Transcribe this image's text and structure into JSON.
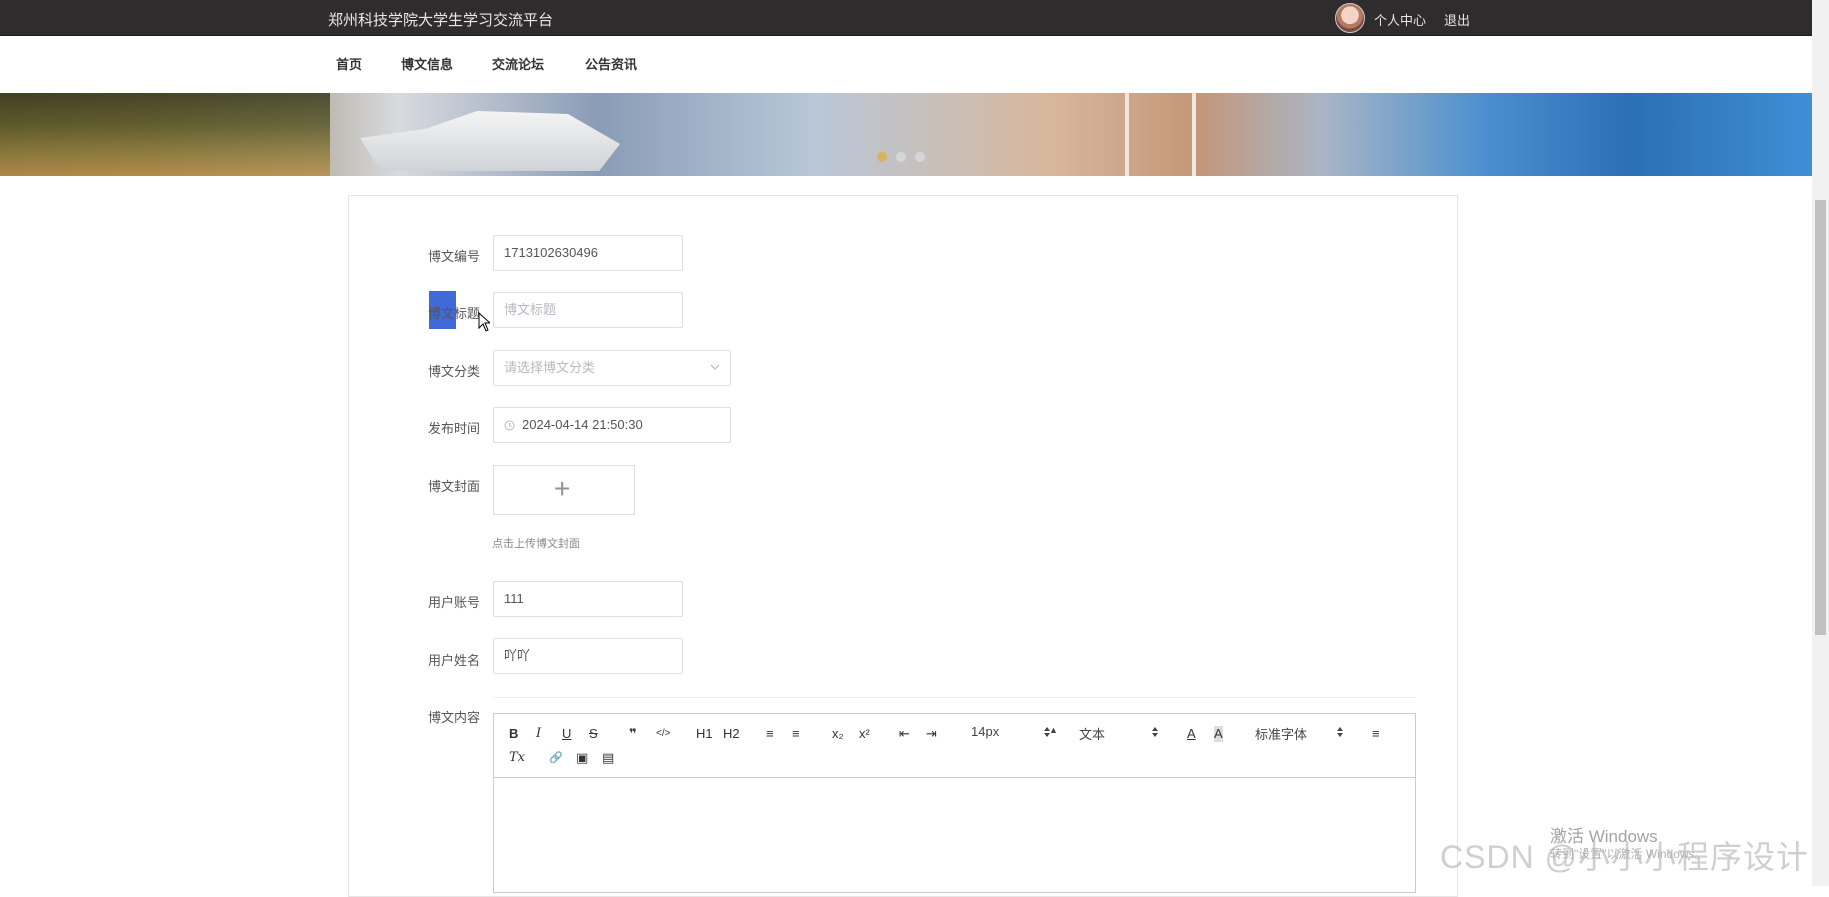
{
  "header": {
    "site_title": "郑州科技学院大学生学习交流平台",
    "user_center": "个人中心",
    "logout": "退出"
  },
  "nav": {
    "items": [
      "首页",
      "博文信息",
      "交流论坛",
      "公告资讯"
    ]
  },
  "form": {
    "blog_id_label": "博文编号",
    "blog_id_value": "1713102630496",
    "title_label": "博文标题",
    "title_placeholder": "博文标题",
    "category_label": "博文分类",
    "category_placeholder": "请选择博文分类",
    "publish_time_label": "发布时间",
    "publish_time_value": "2024-04-14 21:50:30",
    "cover_label": "博文封面",
    "cover_hint": "点击上传博文封面",
    "account_label": "用户账号",
    "account_value": "111",
    "name_label": "用户姓名",
    "name_value": "吖吖",
    "content_label": "博文内容"
  },
  "editor": {
    "font_size": "14px",
    "text_style": "文本",
    "font_family": "标准字体",
    "buttons": {
      "bold": "B",
      "italic": "I",
      "underline": "U",
      "strike": "S",
      "quote": "❞",
      "code": "</>",
      "h1": "H1",
      "h2": "H2",
      "ordered": "≡",
      "bullet": "≡",
      "sub": "x₂",
      "sup": "x²",
      "outdent": "⇤",
      "indent": "⇥",
      "color": "A",
      "background": "A",
      "align": "≡",
      "clean": "Tx",
      "link": "🔗",
      "image": "▣",
      "video": "▤"
    }
  },
  "banner": {
    "slides": 3,
    "active_slide": 1
  },
  "watermark": {
    "windows_line1": "激活 Windows",
    "windows_line2": "转到\"设置\"以激活 Windows。",
    "csdn": "CSDN @小小小程序设计"
  }
}
